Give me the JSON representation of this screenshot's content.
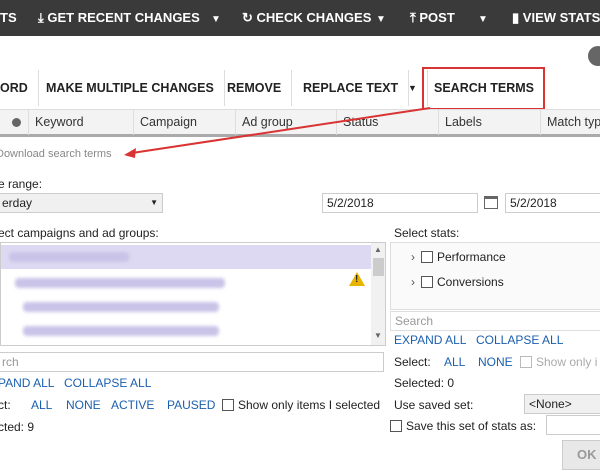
{
  "topbar": {
    "items": [
      {
        "label": "TS"
      },
      {
        "label": "GET RECENT CHANGES"
      },
      {
        "label": "CHECK CHANGES"
      },
      {
        "label": "POST"
      },
      {
        "label": "VIEW STATS"
      }
    ],
    "caret": "▼"
  },
  "toolbar": {
    "items": [
      {
        "label": "ORD"
      },
      {
        "label": "MAKE MULTIPLE CHANGES"
      },
      {
        "label": "REMOVE"
      },
      {
        "label": "REPLACE TEXT"
      },
      {
        "label": "SEARCH TERMS"
      }
    ],
    "caret": "▼"
  },
  "columns": [
    "Keyword",
    "Campaign",
    "Ad group",
    "Status",
    "Labels",
    "Match type"
  ],
  "download_link": "Download search terms",
  "date_range": {
    "label": "e range:",
    "preset": "erday",
    "start": "5/2/2018",
    "end": "5/2/2018"
  },
  "campaigns": {
    "label": "ect campaigns and ad groups:",
    "search_placeholder": "rch",
    "expand_all": "PAND ALL",
    "collapse_all": "COLLAPSE ALL",
    "select_label": "ct:",
    "options": [
      "ALL",
      "NONE",
      "ACTIVE",
      "PAUSED"
    ],
    "show_only_selected": "Show only items I selected",
    "selected_label": "cted: 9"
  },
  "stats": {
    "label": "Select stats:",
    "items": [
      "Performance",
      "Conversions"
    ],
    "search_placeholder": "Search",
    "expand_all": "EXPAND ALL",
    "collapse_all": "COLLAPSE ALL",
    "select_label": "Select:",
    "options": [
      "ALL",
      "NONE"
    ],
    "show_only": "Show only i",
    "selected_label": "Selected: 0",
    "saved_set_label": "Use saved set:",
    "saved_set_value": "<None>",
    "save_set_label": "Save this set of stats as:"
  },
  "ok_label": "OK",
  "colors": {
    "accent": "#1b5fb0",
    "highlight": "#d93333",
    "topbar": "#3a3a3a"
  }
}
